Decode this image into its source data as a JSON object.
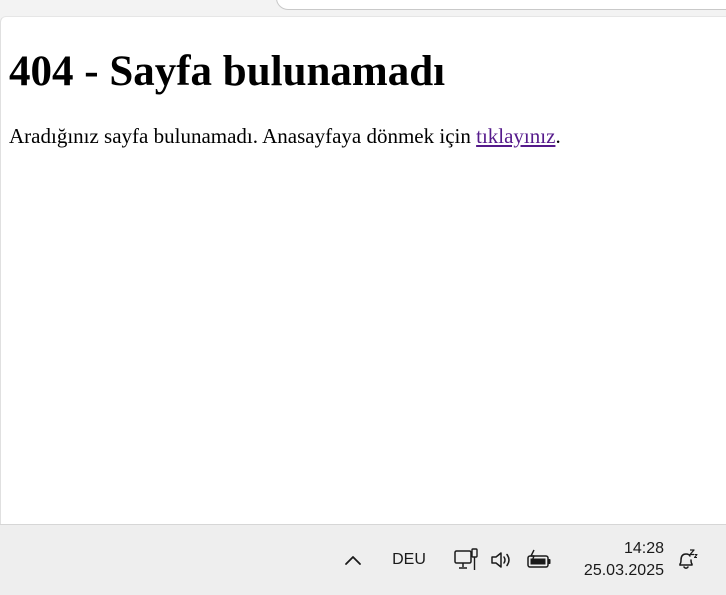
{
  "page": {
    "heading": "404 - Sayfa bulunamadı",
    "message_before_link": "Aradığınız sayfa bulunamadı. Anasayfaya dönmek için ",
    "link_text": "tıklayınız",
    "message_after_link": "."
  },
  "colors": {
    "visited_link": "#551a8b",
    "taskbar_bg": "#eeeeee"
  },
  "taskbar": {
    "tray_overflow_icon": "chevron-up-icon",
    "language": "DEU",
    "network_icon": "network-wired-icon",
    "volume_icon": "speaker-icon",
    "battery_icon": "battery-charging-icon",
    "time": "14:28",
    "date": "25.03.2025",
    "notification_icon": "notification-bell-dnd-icon"
  }
}
